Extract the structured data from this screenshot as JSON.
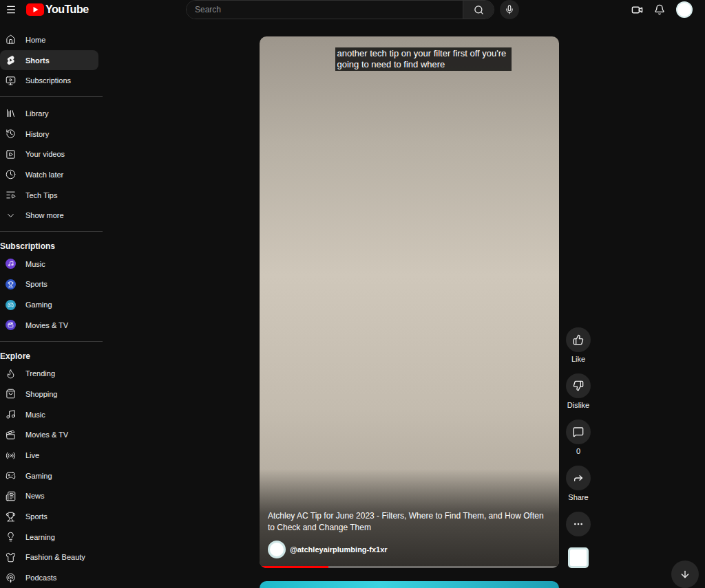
{
  "header": {
    "logo": "YouTube",
    "search": {
      "placeholder": "Search"
    }
  },
  "sidebar": {
    "main": [
      {
        "label": "Home",
        "selected": false
      },
      {
        "label": "Shorts",
        "selected": true
      },
      {
        "label": "Subscriptions",
        "selected": false
      }
    ],
    "library": [
      {
        "label": "Library",
        "selected": false
      },
      {
        "label": "History",
        "selected": false
      },
      {
        "label": "Your videos",
        "selected": false
      },
      {
        "label": "Watch later",
        "selected": false
      },
      {
        "label": "Tech Tips",
        "selected": false
      },
      {
        "label": "Show more",
        "selected": false
      }
    ],
    "subscriptions": {
      "heading": "Subscriptions",
      "items": [
        {
          "label": "Music",
          "selected": false,
          "color": "#6d3fd6"
        },
        {
          "label": "Sports",
          "selected": false,
          "color": "#2f56c9"
        },
        {
          "label": "Gaming",
          "selected": false,
          "color": "#2a9fc4"
        },
        {
          "label": "Movies & TV",
          "selected": false,
          "color": "#5a3fd0"
        }
      ]
    },
    "explore": {
      "heading": "Explore",
      "items": [
        {
          "label": "Trending",
          "selected": false
        },
        {
          "label": "Shopping",
          "selected": false
        },
        {
          "label": "Music",
          "selected": false
        },
        {
          "label": "Movies & TV",
          "selected": false
        },
        {
          "label": "Live",
          "selected": false
        },
        {
          "label": "Gaming",
          "selected": false
        },
        {
          "label": "News",
          "selected": false
        },
        {
          "label": "Sports",
          "selected": false
        },
        {
          "label": "Learning",
          "selected": false
        },
        {
          "label": "Fashion & Beauty",
          "selected": false
        },
        {
          "label": "Podcasts",
          "selected": false
        }
      ]
    }
  },
  "short": {
    "caption": "another tech tip on your filter first off you're going to need to find where",
    "title": "Atchley AC Tip for June 2023 - Filters, Where to Find Them, and How Often to Check and Change Them",
    "channel": "@atchleyairplumbing-fx1xr",
    "level": 0.23
  },
  "actions": [
    {
      "kind": "like",
      "label": "Like"
    },
    {
      "kind": "dislike",
      "label": "Dislike"
    },
    {
      "kind": "comments",
      "label": "0"
    },
    {
      "kind": "share",
      "label": "Share"
    },
    {
      "kind": "more"
    }
  ]
}
